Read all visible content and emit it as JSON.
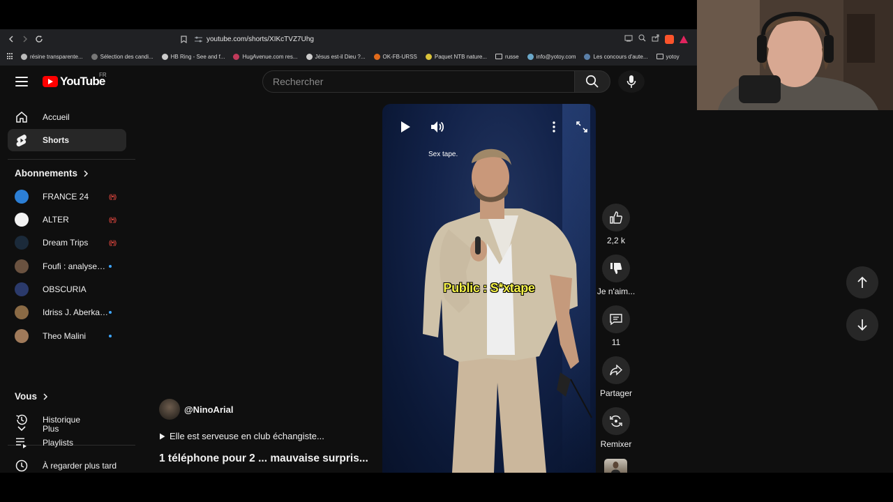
{
  "browser": {
    "url": "youtube.com/shorts/XIKcTVZ7Uhg",
    "bookmarks": [
      {
        "label": "résine transparente...",
        "color": "#bbbbbb"
      },
      {
        "label": "Sélection des candi...",
        "color": "#777777"
      },
      {
        "label": "HB Ring - See and f...",
        "color": "#cccccc"
      },
      {
        "label": "HugAvenue.com res...",
        "color": "#c03a5a"
      },
      {
        "label": "Jésus est-il Dieu ?...",
        "color": "#cccccc"
      },
      {
        "label": "OK-FB-URSS",
        "color": "#e06a1b"
      },
      {
        "label": "Paquet NTB nature...",
        "color": "#d9c23a"
      },
      {
        "label": "russe",
        "color": "folder"
      },
      {
        "label": "info@yotoy.com",
        "color": "#6aa7c9"
      },
      {
        "label": "Les concours d'aute...",
        "color": "#5a7fa8"
      },
      {
        "label": "yotoy",
        "color": "folder"
      }
    ]
  },
  "masthead": {
    "logo_text": "YouTube",
    "country": "FR",
    "search_placeholder": "Rechercher"
  },
  "sidebar": {
    "main": [
      {
        "label": "Accueil",
        "icon": "home-icon"
      },
      {
        "label": "Shorts",
        "icon": "shorts-icon",
        "active": true
      }
    ],
    "subscriptions_header": "Abonnements",
    "subscriptions": [
      {
        "label": "FRANCE 24",
        "status": "live",
        "color": "#2c7fd6"
      },
      {
        "label": "ALTER",
        "status": "live",
        "color": "#f2f2f2"
      },
      {
        "label": "Dream Trips",
        "status": "live",
        "color": "#1b2a3a"
      },
      {
        "label": "Foufi : analyses ...",
        "status": "new",
        "color": "#6a5240"
      },
      {
        "label": "OBSCURIA",
        "status": "",
        "color": "#2b3a6b"
      },
      {
        "label": "Idriss J. Aberkane",
        "status": "new",
        "color": "#8a6a45"
      },
      {
        "label": "Theo Malini",
        "status": "new",
        "color": "#a07a5a"
      }
    ],
    "more_label": "Plus",
    "you_header": "Vous",
    "you": [
      {
        "label": "Historique",
        "icon": "history-icon"
      },
      {
        "label": "Playlists",
        "icon": "playlists-icon"
      },
      {
        "label": "À regarder plus tard",
        "icon": "watch-later-icon"
      }
    ]
  },
  "video": {
    "caption_top": "Sex tape.",
    "caption_main": "Public : S*xtape"
  },
  "actions": {
    "like_count": "2,2 k",
    "dislike_label": "Je n'aim...",
    "comments_count": "11",
    "share_label": "Partager",
    "remix_label": "Remixer"
  },
  "info": {
    "channel": "@NinoArial",
    "description": "Elle est serveuse en club échangiste...",
    "title": "1 téléphone pour 2 ... mauvaise surpris..."
  }
}
